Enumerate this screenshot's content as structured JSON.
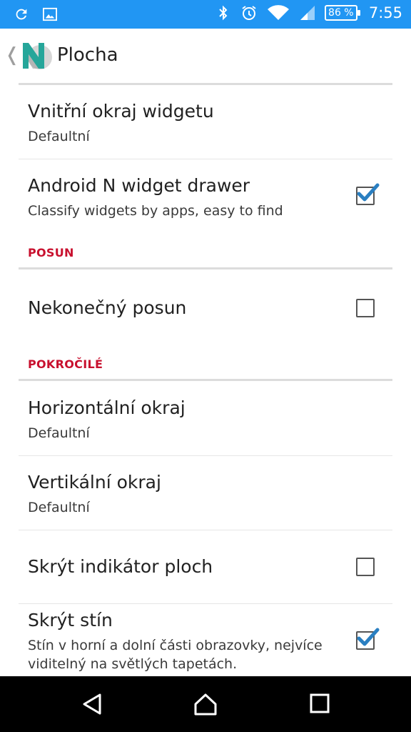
{
  "status_bar": {
    "battery_percent": "86 %",
    "time": "7:55",
    "icons": [
      "sync-icon",
      "image-icon",
      "bluetooth-icon",
      "alarm-icon",
      "wifi-icon",
      "signal-icon",
      "battery-icon"
    ],
    "background": "#2196f3"
  },
  "app_bar": {
    "title": "Plocha",
    "back_glyph": "❬",
    "logo_letter": "N",
    "logo_color": "#26a69a"
  },
  "sections": {
    "scroll": "POSUN",
    "advanced": "POKROČILÉ"
  },
  "preferences": [
    {
      "title": "Vnitřní okraj widgetu",
      "summary": "Defaultní"
    },
    {
      "title": "Android N widget drawer",
      "summary": "Classify widgets by apps, easy to find",
      "checked": true
    },
    {
      "title": "Nekonečný posun",
      "checked": false
    },
    {
      "title": "Horizontální okraj",
      "summary": "Defaultní"
    },
    {
      "title": "Vertikální okraj",
      "summary": "Defaultní"
    },
    {
      "title": "Skrýt indikátor ploch",
      "checked": false
    },
    {
      "title": "Skrýt stín",
      "summary_line1": "Stín v horní a dolní části obrazovky, nejvíce",
      "summary_line2": "viditelný na světlých tapetách.",
      "checked": true
    }
  ],
  "colors": {
    "accent": "#2a7fc1",
    "section_header": "#c8102e"
  }
}
